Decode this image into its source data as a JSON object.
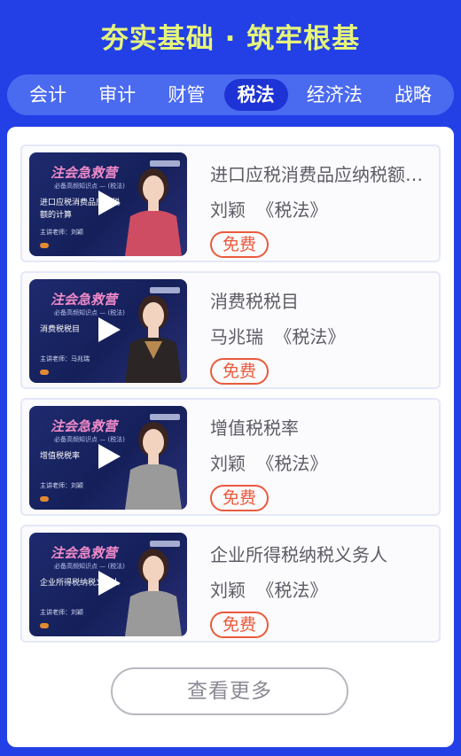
{
  "banner": {
    "title": "夯实基础 · 筑牢根基"
  },
  "tabs": [
    {
      "label": "会计",
      "active": false
    },
    {
      "label": "审计",
      "active": false
    },
    {
      "label": "财管",
      "active": false
    },
    {
      "label": "税法",
      "active": true
    },
    {
      "label": "经济法",
      "active": false
    },
    {
      "label": "战略",
      "active": false
    }
  ],
  "courses": [
    {
      "title": "进口应税消费品应纳税额的计算",
      "teacher": "刘颖",
      "subject": "《税法》",
      "badge": "免费",
      "thumb": {
        "brand": "注会急救营",
        "sub": "必备高频知识点 — (税法)",
        "lines": "进口应税消费品应纳税额的计算",
        "teacher_line": "主讲老师：刘颖"
      }
    },
    {
      "title": "消费税税目",
      "teacher": "马兆瑞",
      "subject": "《税法》",
      "badge": "免费",
      "thumb": {
        "brand": "注会急救营",
        "sub": "必备高频知识点 — (税法)",
        "lines": "消费税税目",
        "teacher_line": "主讲老师：马兆瑞"
      }
    },
    {
      "title": "增值税税率",
      "teacher": "刘颖",
      "subject": "《税法》",
      "badge": "免费",
      "thumb": {
        "brand": "注会急救营",
        "sub": "必备高频知识点 — (税法)",
        "lines": "增值税税率",
        "teacher_line": "主讲老师：刘颖"
      }
    },
    {
      "title": "企业所得税纳税义务人",
      "teacher": "刘颖",
      "subject": "《税法》",
      "badge": "免费",
      "thumb": {
        "brand": "注会急救营",
        "sub": "必备高频知识点 — (税法)",
        "lines": "企业所得税纳税义务人",
        "teacher_line": "主讲老师：刘颖"
      }
    }
  ],
  "more_button": {
    "label": "查看更多"
  },
  "colors": {
    "background": "#2340e6",
    "banner_title": "#e6f57a",
    "badge": "#ea5a3c",
    "active_tab": "#1d33d6"
  },
  "icons": {
    "play": "play-icon"
  }
}
